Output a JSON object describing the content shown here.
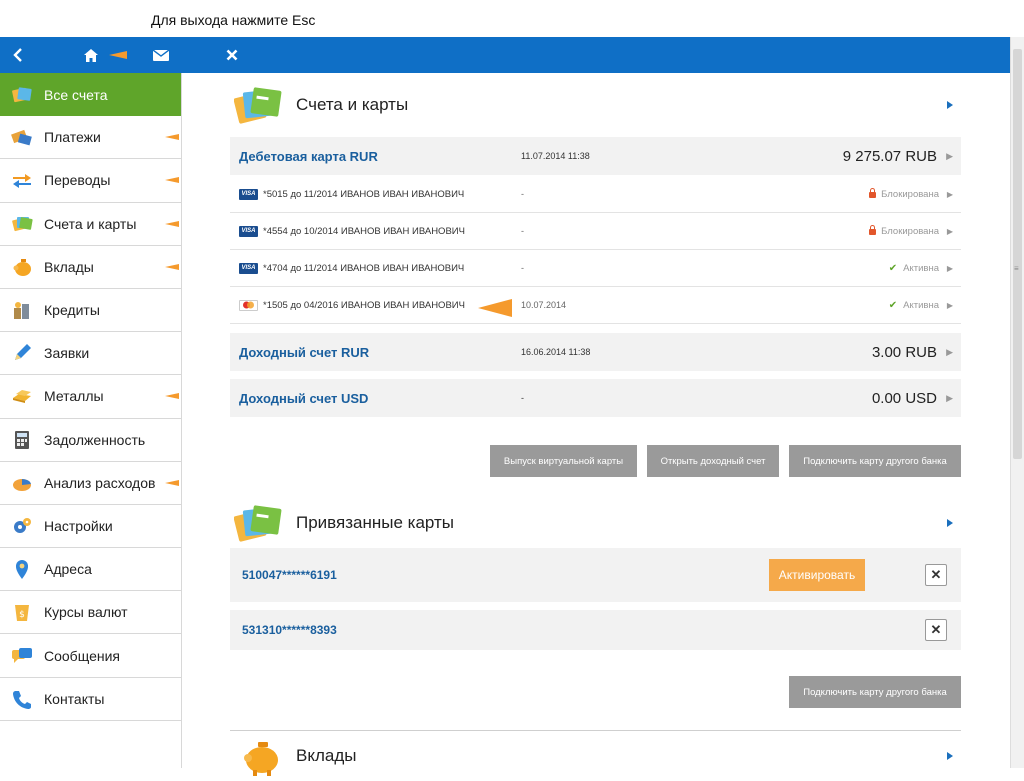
{
  "hint": "Для выхода нажмите Esc",
  "sidebar": {
    "items": [
      {
        "label": "Все счета",
        "icon": "all-accounts-icon",
        "active": true,
        "arrow": false
      },
      {
        "label": "Платежи",
        "icon": "payments-icon",
        "active": false,
        "arrow": true
      },
      {
        "label": "Переводы",
        "icon": "transfers-icon",
        "active": false,
        "arrow": true
      },
      {
        "label": "Счета и карты",
        "icon": "accounts-cards-icon",
        "active": false,
        "arrow": true
      },
      {
        "label": "Вклады",
        "icon": "deposits-icon",
        "active": false,
        "arrow": true
      },
      {
        "label": "Кредиты",
        "icon": "credits-icon",
        "active": false,
        "arrow": false
      },
      {
        "label": "Заявки",
        "icon": "requests-icon",
        "active": false,
        "arrow": false
      },
      {
        "label": "Металлы",
        "icon": "metals-icon",
        "active": false,
        "arrow": true
      },
      {
        "label": "Задолженность",
        "icon": "debt-icon",
        "active": false,
        "arrow": false
      },
      {
        "label": "Анализ расходов",
        "icon": "expense-analysis-icon",
        "active": false,
        "arrow": true
      },
      {
        "label": "Настройки",
        "icon": "settings-icon",
        "active": false,
        "arrow": false
      },
      {
        "label": "Адреса",
        "icon": "addresses-icon",
        "active": false,
        "arrow": false
      },
      {
        "label": "Курсы валют",
        "icon": "currency-rates-icon",
        "active": false,
        "arrow": false
      },
      {
        "label": "Сообщения",
        "icon": "messages-icon",
        "active": false,
        "arrow": false
      },
      {
        "label": "Контакты",
        "icon": "contacts-icon",
        "active": false,
        "arrow": false
      }
    ]
  },
  "accounts_section": {
    "title": "Счета и карты",
    "debit": {
      "name": "Дебетовая карта RUR",
      "date": "11.07.2014 11:38",
      "amount": "9 275.07 RUB"
    },
    "cards": [
      {
        "brand": "VISA",
        "text": "*5015 до 11/2014 ИВАНОВ ИВАН ИВАНОВИЧ",
        "date": "-",
        "status": "Блокирована",
        "state": "blocked"
      },
      {
        "brand": "VISA",
        "text": "*4554 до 10/2014 ИВАНОВ ИВАН ИВАНОВИЧ",
        "date": "-",
        "status": "Блокирована",
        "state": "blocked"
      },
      {
        "brand": "VISA",
        "text": "*4704 до 11/2014 ИВАНОВ ИВАН ИВАНОВИЧ",
        "date": "-",
        "status": "Активна",
        "state": "active"
      },
      {
        "brand": "MC",
        "text": "*1505 до 04/2016 ИВАНОВ ИВАН ИВАНОВИЧ",
        "date": "10.07.2014",
        "status": "Активна",
        "state": "active"
      }
    ],
    "income_rur": {
      "name": "Доходный счет RUR",
      "date": "16.06.2014 11:38",
      "amount": "3.00 RUB"
    },
    "income_usd": {
      "name": "Доходный счет USD",
      "date": "-",
      "amount": "0.00 USD"
    },
    "buttons": {
      "virtual_card": "Выпуск виртуальной карты",
      "open_income": "Открыть доходный счет",
      "connect_other": "Подключить карту другого банка"
    }
  },
  "linked_section": {
    "title": "Привязанные карты",
    "cards": [
      {
        "number": "510047******6191",
        "activate": "Активировать"
      },
      {
        "number": "531310******8393"
      }
    ],
    "connect_other": "Подключить карту другого банка"
  },
  "deposits_section": {
    "title": "Вклады"
  },
  "colors": {
    "topbar": "#0f6fc6",
    "active": "#5fa52a",
    "accent_orange": "#f59a2d",
    "link_blue": "#1a5f9e"
  }
}
